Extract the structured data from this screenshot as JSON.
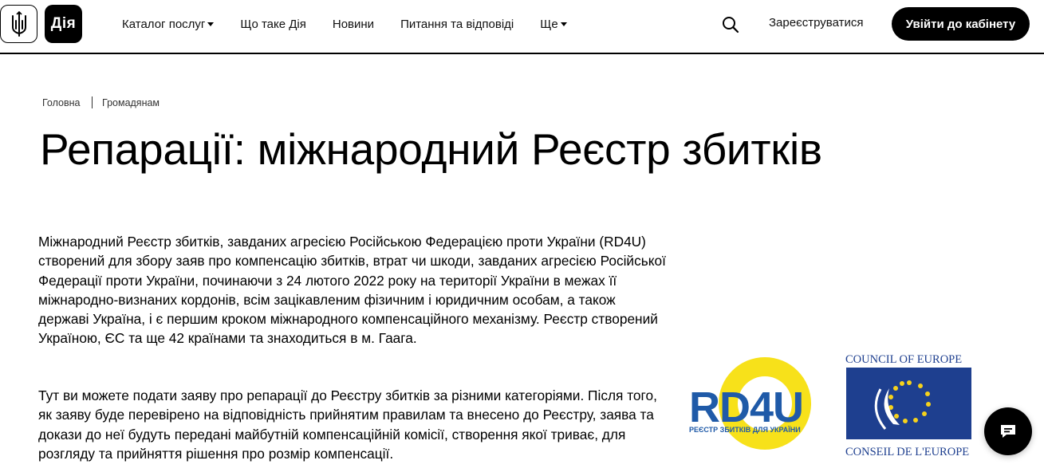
{
  "header": {
    "brand": "Дія",
    "nav": [
      {
        "label": "Каталог послуг",
        "dropdown": true
      },
      {
        "label": "Що таке Дія",
        "dropdown": false
      },
      {
        "label": "Новини",
        "dropdown": false
      },
      {
        "label": "Питання та відповіді",
        "dropdown": false
      },
      {
        "label": "Ще",
        "dropdown": true
      }
    ],
    "register_label": "Зареєструватися",
    "login_label": "Увійти до кабінету"
  },
  "breadcrumb": [
    "Головна",
    "Громадянам"
  ],
  "page_title": "Репарації: міжнародний Реєстр збитків",
  "paragraphs": [
    "Міжнародний Реєстр збитків, завданих агресією Російською Федерацією проти України (RD4U) створений для збору заяв про компенсацію збитків, втрат чи шкоди, завданих агресією Російської Федерації проти України, починаючи з 24 лютого 2022 року на території України в межах її міжнародно-визнаних кордонів, всім зацікавленим фізичним і юридичним особам, а також державі Україна, і є першим кроком міжнародного компенсаційного механізму. Реєстр створений Україною, ЄС та ще 42 країнами та знаходиться в м. Гаага.",
    "Тут ви можете подати заяву про репарації до Реєстру збитків за різними категоріями. Після того, як заяву буде перевірено на відповідність прийнятим правилам та внесено до Реєстру, заява та докази до неї будуть передані майбутній компенсаційній комісії, створення якої триває, для розгляду та прийняття рішення про розмір компенсації."
  ],
  "logos": {
    "rd4u_text": "RD4U",
    "rd4u_subtitle": "РЕЄСТР ЗБИТКІВ ДЛЯ УКРАЇНИ",
    "coe_top": "COUNCIL OF EUROPE",
    "coe_bottom": "CONSEIL DE L'EUROPE"
  },
  "colors": {
    "accent": "#000000",
    "rd4u_yellow": "#f7e11a",
    "rd4u_blue": "#1f5aa8",
    "coe_blue": "#1e3f8f",
    "coe_star": "#f6d21b"
  }
}
